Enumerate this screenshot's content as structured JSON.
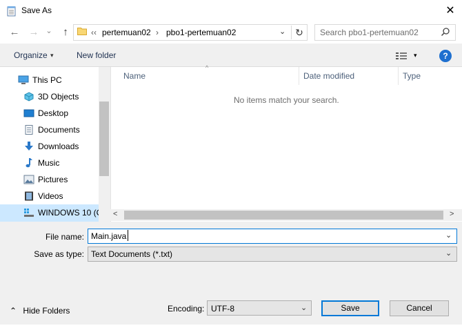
{
  "window": {
    "title": "Save As",
    "close_glyph": "✕"
  },
  "nav": {
    "back_glyph": "←",
    "forward_glyph": "→",
    "dropdown_glyph": "⌄",
    "up_glyph": "↑",
    "breadcrumb_overflow": "‹‹",
    "breadcrumb": [
      "pertemuan02",
      "pbo1-pertemuan02"
    ],
    "breadcrumb_sep": "›",
    "address_dropdown_glyph": "⌄",
    "refresh_glyph": "↻",
    "search_placeholder": "Search pbo1-pertemuan02"
  },
  "toolbar": {
    "organize_label": "Organize",
    "organize_caret": "▾",
    "new_folder_label": "New folder",
    "view_caret": "▾",
    "help_label": "?"
  },
  "navpane": {
    "items": [
      {
        "label": "This PC",
        "icon": "pc-icon"
      },
      {
        "label": "3D Objects",
        "icon": "3d-objects-icon"
      },
      {
        "label": "Desktop",
        "icon": "desktop-icon"
      },
      {
        "label": "Documents",
        "icon": "documents-icon"
      },
      {
        "label": "Downloads",
        "icon": "downloads-icon"
      },
      {
        "label": "Music",
        "icon": "music-icon"
      },
      {
        "label": "Pictures",
        "icon": "pictures-icon"
      },
      {
        "label": "Videos",
        "icon": "videos-icon"
      },
      {
        "label": "WINDOWS 10 (C",
        "icon": "drive-icon"
      }
    ],
    "selected_index": 8
  },
  "filelist": {
    "columns": [
      "Name",
      "Date modified",
      "Type"
    ],
    "sort_glyph": "^",
    "empty_message": "No items match your search.",
    "scroll_left_glyph": "<",
    "scroll_right_glyph": ">"
  },
  "form": {
    "file_name_label": "File name:",
    "file_name_value": "Main.java",
    "save_as_type_label": "Save as type:",
    "save_as_type_value": "Text Documents (*.txt)",
    "dropdown_glyph": "⌄"
  },
  "footer": {
    "hide_folders_glyph": "⌃",
    "hide_folders_label": "Hide Folders",
    "encoding_label": "Encoding:",
    "encoding_value": "UTF-8",
    "save_label": "Save",
    "cancel_label": "Cancel"
  },
  "colors": {
    "accent": "#0078d7",
    "selection": "#cce8ff",
    "dialog_bg": "#f0f0f0",
    "help_blue": "#1e6fcf"
  }
}
